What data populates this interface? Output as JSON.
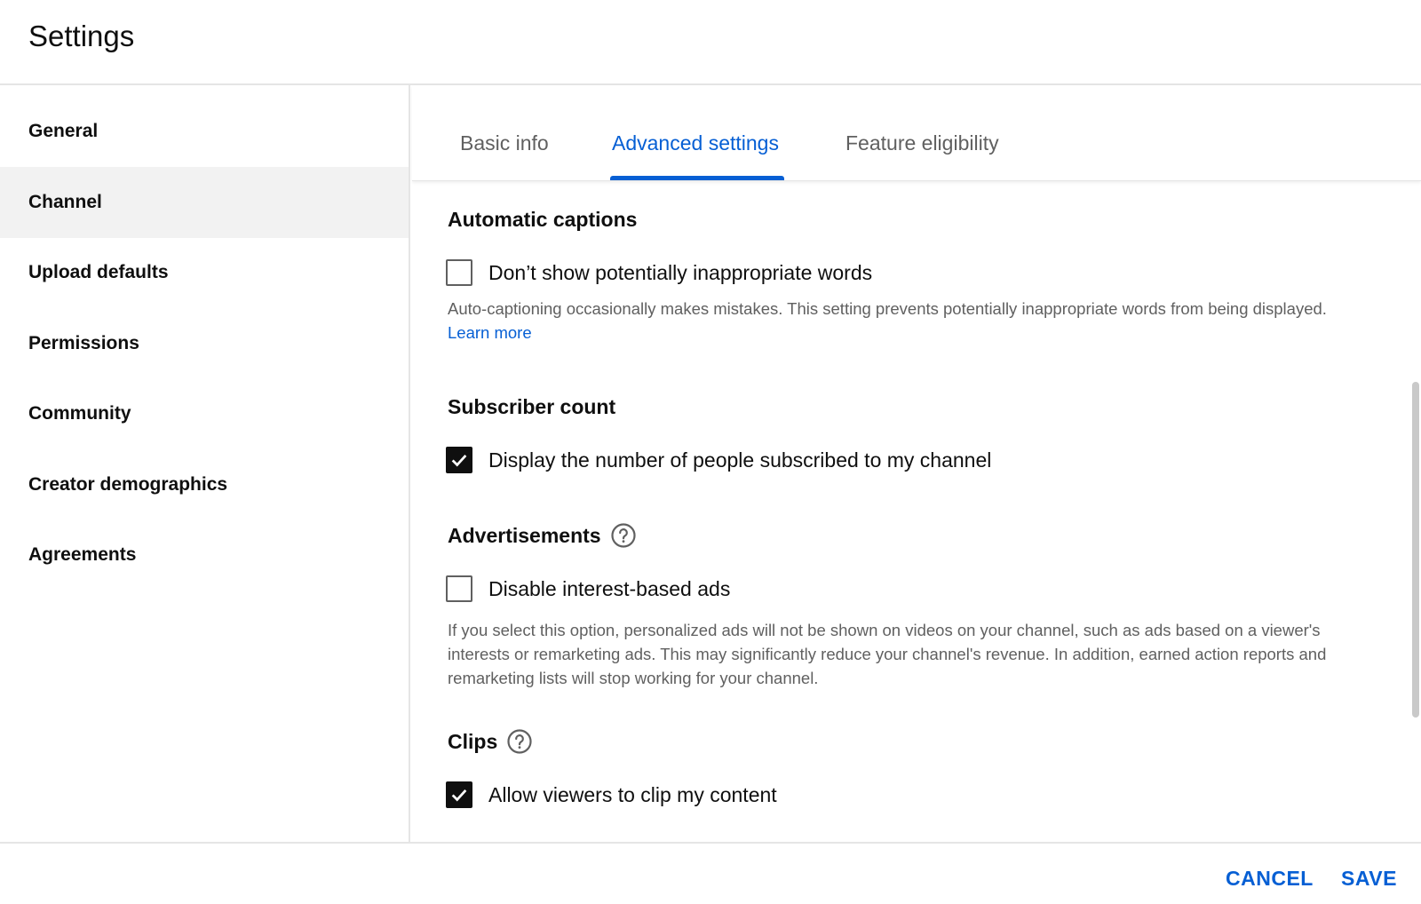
{
  "header": {
    "title": "Settings"
  },
  "sidebar": {
    "items": [
      {
        "label": "General"
      },
      {
        "label": "Channel"
      },
      {
        "label": "Upload defaults"
      },
      {
        "label": "Permissions"
      },
      {
        "label": "Community"
      },
      {
        "label": "Creator demographics"
      },
      {
        "label": "Agreements"
      }
    ],
    "active": "Channel"
  },
  "tabs": {
    "items": [
      {
        "label": "Basic info"
      },
      {
        "label": "Advanced settings"
      },
      {
        "label": "Feature eligibility"
      }
    ],
    "active": "Advanced settings"
  },
  "sections": {
    "captions": {
      "title": "Automatic captions",
      "checkbox_label": "Don’t show potentially inappropriate words",
      "checked": false,
      "description": "Auto-captioning occasionally makes mistakes. This setting prevents potentially inappropriate words from being displayed.",
      "link": "Learn more"
    },
    "subscribers": {
      "title": "Subscriber count",
      "checkbox_label": "Display the number of people subscribed to my channel",
      "checked": true
    },
    "ads": {
      "title": "Advertisements",
      "checkbox_label": "Disable interest-based ads",
      "checked": false,
      "description": "If you select this option, personalized ads will not be shown on videos on your channel, such as ads based on a viewer's interests or remarketing ads. This may significantly reduce your channel's revenue. In addition, earned action reports and remarketing lists will stop working for your channel."
    },
    "clips": {
      "title": "Clips",
      "checkbox_label": "Allow viewers to clip my content",
      "checked": true
    }
  },
  "footer": {
    "cancel": "CANCEL",
    "save": "SAVE"
  },
  "colors": {
    "accent": "#065fd4",
    "text": "#0f0f0f",
    "secondary": "#606060",
    "active_bg": "#f2f2f2",
    "divider": "#e5e5e5"
  }
}
